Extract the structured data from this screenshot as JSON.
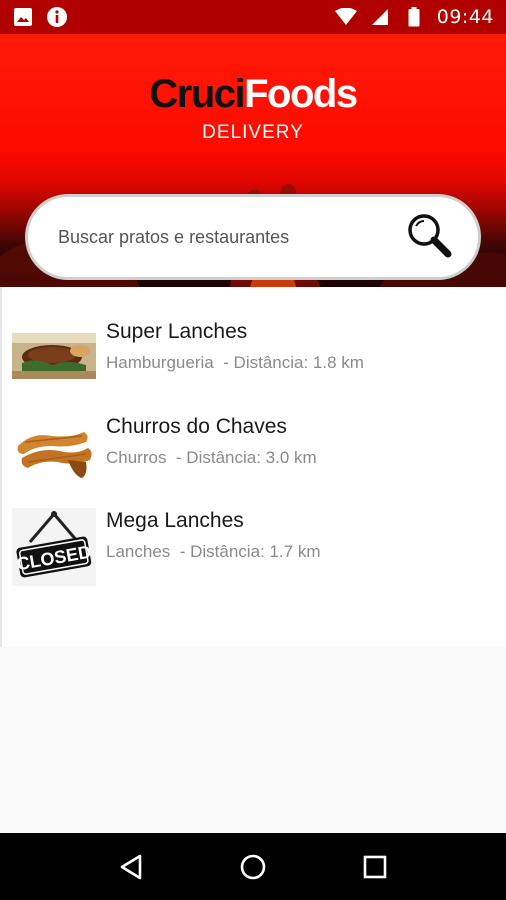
{
  "status_bar": {
    "time": "09:44",
    "left_icons": [
      "image-icon",
      "info-icon"
    ],
    "right_icons": [
      "wifi-icon",
      "signal-icon",
      "battery-icon"
    ]
  },
  "header": {
    "logo_part1": "Cruci",
    "logo_part2": "Foods",
    "subtitle": "DELIVERY"
  },
  "search": {
    "placeholder": "Buscar pratos e restaurantes",
    "icon": "search-icon"
  },
  "restaurants": [
    {
      "name": "Super Lanches",
      "meta": "Hamburgueria  - Distância: 1.8 km",
      "thumb": "burger-thumbnail"
    },
    {
      "name": "Churros do Chaves",
      "meta": "Churros  - Distância: 3.0 km",
      "thumb": "churros-thumbnail"
    },
    {
      "name": "Mega Lanches",
      "meta": "Lanches  - Distância: 1.7 km",
      "thumb": "closed-sign-thumbnail",
      "sign_text": "CLOSED"
    }
  ],
  "nav": [
    "back-icon",
    "home-icon",
    "recents-icon"
  ],
  "colors": {
    "brand_red": "#ff0a00",
    "status_bar": "#b00000",
    "text_primary": "#1a1a1a",
    "text_secondary": "#8a8a8a"
  }
}
